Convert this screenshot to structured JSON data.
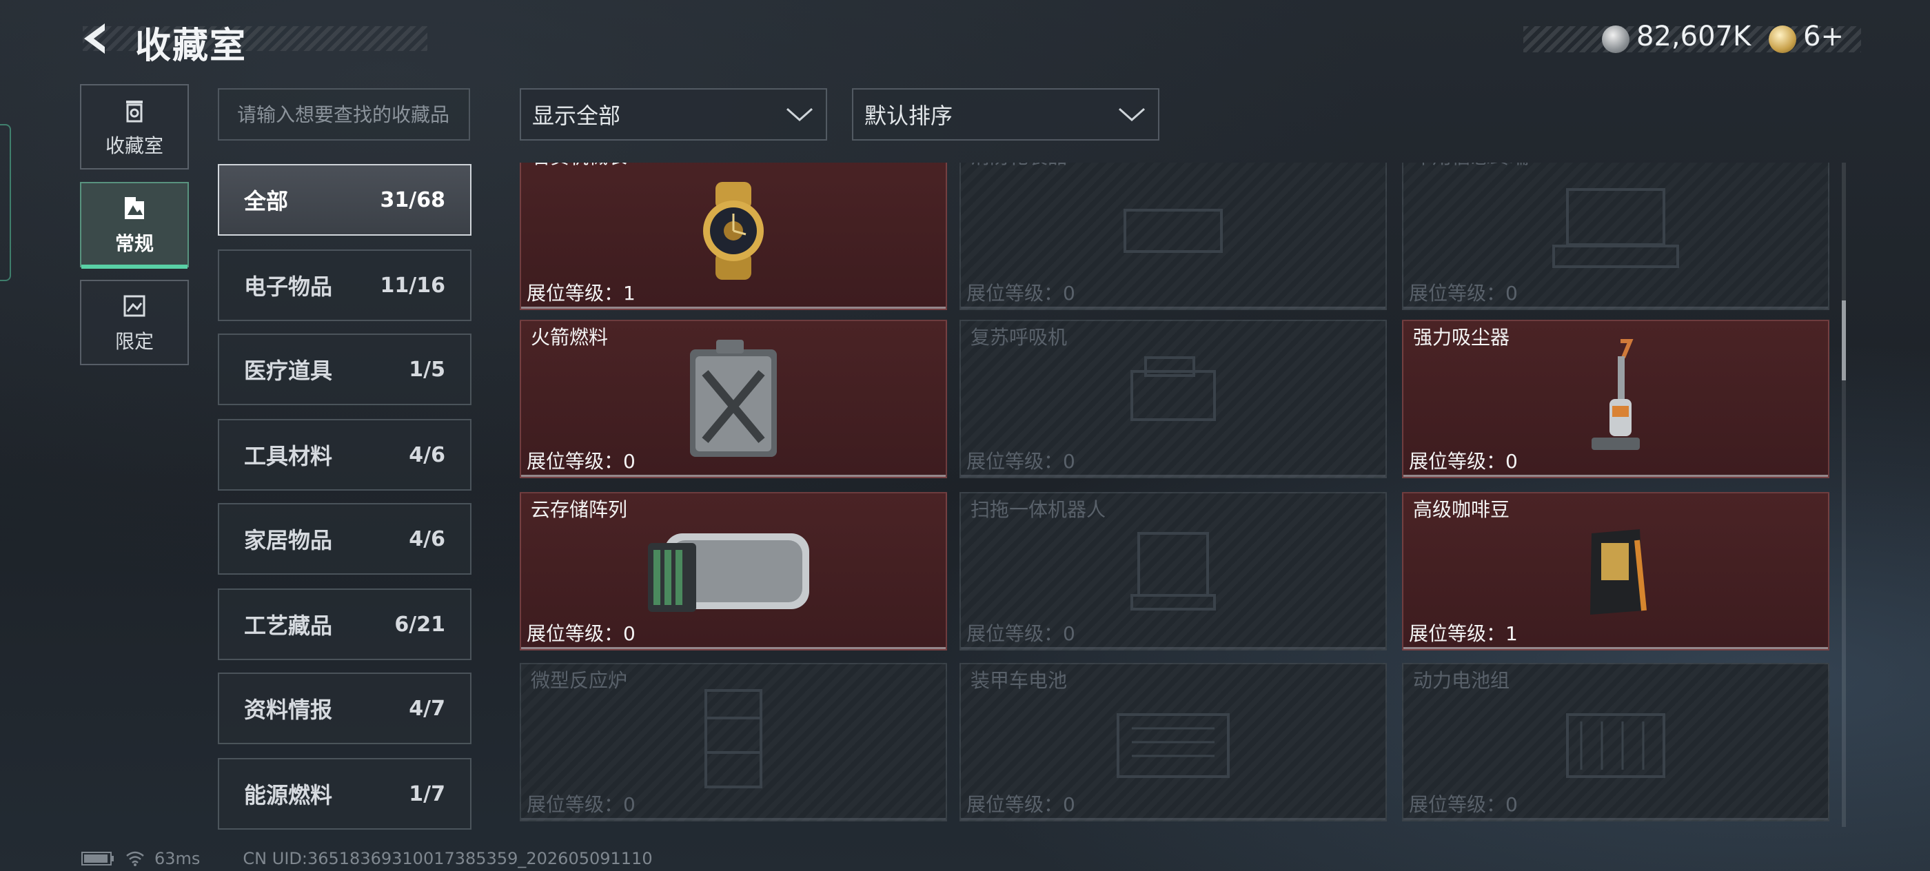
{
  "header": {
    "title": "收藏室"
  },
  "currency": {
    "silver": "82,607K",
    "gold": "6+"
  },
  "mode_tabs": [
    {
      "label": "收藏室",
      "icon": "trash-bin-icon",
      "active": false
    },
    {
      "label": "常规",
      "icon": "collection-image-icon",
      "active": true
    },
    {
      "label": "限定",
      "icon": "limited-image-icon",
      "active": false
    }
  ],
  "search": {
    "placeholder": "请输入想要查找的收藏品"
  },
  "categories": [
    {
      "name": "全部",
      "count": "31/68",
      "active": true
    },
    {
      "name": "电子物品",
      "count": "11/16"
    },
    {
      "name": "医疗道具",
      "count": "1/5"
    },
    {
      "name": "工具材料",
      "count": "4/6"
    },
    {
      "name": "家居物品",
      "count": "4/6"
    },
    {
      "name": "工艺藏品",
      "count": "6/21"
    },
    {
      "name": "资料情报",
      "count": "4/7"
    },
    {
      "name": "能源燃料",
      "count": "1/7"
    }
  ],
  "filters": {
    "show": "显示全部",
    "sort": "默认排序"
  },
  "level_prefix": "展位等级：",
  "items": [
    {
      "name": "名贵机械表",
      "level": "1",
      "owned": true,
      "art": "gold-watch"
    },
    {
      "name": "消防化装品",
      "level": "0",
      "owned": false,
      "art": "device"
    },
    {
      "name": "军用信息终端",
      "level": "0",
      "owned": false,
      "art": "laptop"
    },
    {
      "name": "火箭燃料",
      "level": "0",
      "owned": true,
      "art": "jerrycan"
    },
    {
      "name": "复苏呼吸机",
      "level": "0",
      "owned": false,
      "art": "device"
    },
    {
      "name": "强力吸尘器",
      "level": "0",
      "owned": true,
      "art": "vacuum"
    },
    {
      "name": "云存储阵列",
      "level": "0",
      "owned": true,
      "art": "server"
    },
    {
      "name": "扫拖一体机器人",
      "level": "0",
      "owned": false,
      "art": "device"
    },
    {
      "name": "高级咖啡豆",
      "level": "1",
      "owned": true,
      "art": "coffee-bag"
    },
    {
      "name": "微型反应炉",
      "level": "0",
      "owned": false,
      "art": "reactor"
    },
    {
      "name": "装甲车电池",
      "level": "0",
      "owned": false,
      "art": "battery"
    },
    {
      "name": "动力电池组",
      "level": "0",
      "owned": false,
      "art": "battery"
    }
  ],
  "footer": {
    "ping": "63ms",
    "uid": "CN UID:36518369310017385359_202605091110"
  }
}
